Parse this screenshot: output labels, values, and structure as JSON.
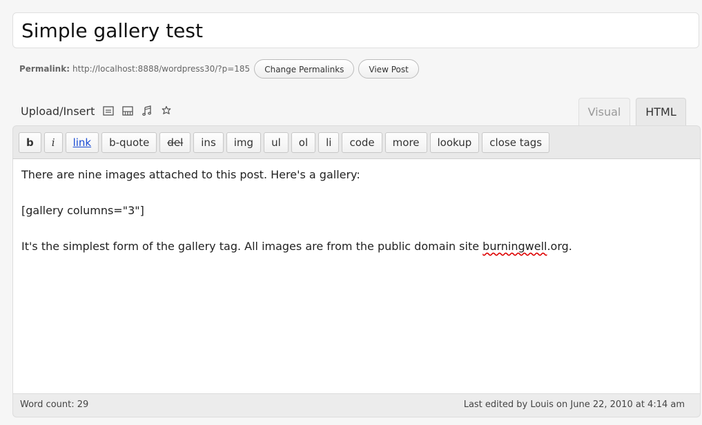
{
  "post_title": "Simple gallery test",
  "permalink": {
    "label": "Permalink:",
    "url": "http://localhost:8888/wordpress30/?p=185",
    "change_button": "Change Permalinks",
    "view_button": "View Post"
  },
  "media": {
    "label": "Upload/Insert",
    "icons": [
      "image-icon",
      "gallery-icon",
      "music-icon",
      "media-icon"
    ]
  },
  "tabs": {
    "visual": "Visual",
    "html": "HTML"
  },
  "toolbar": {
    "buttons": [
      "b",
      "i",
      "link",
      "b-quote",
      "del",
      "ins",
      "img",
      "ul",
      "ol",
      "li",
      "code",
      "more",
      "lookup",
      "close tags"
    ]
  },
  "content": {
    "p1": "There are nine images attached to this post.  Here's a gallery:",
    "p2": "[gallery columns=\"3\"]",
    "p3_before": "It's the simplest form of the gallery tag.  All images are from the public domain site ",
    "p3_misspelled": "burningwell",
    "p3_after": ".org."
  },
  "status": {
    "word_count": "Word count: 29",
    "last_edited": "Last edited by Louis on June 22, 2010 at 4:14 am"
  }
}
